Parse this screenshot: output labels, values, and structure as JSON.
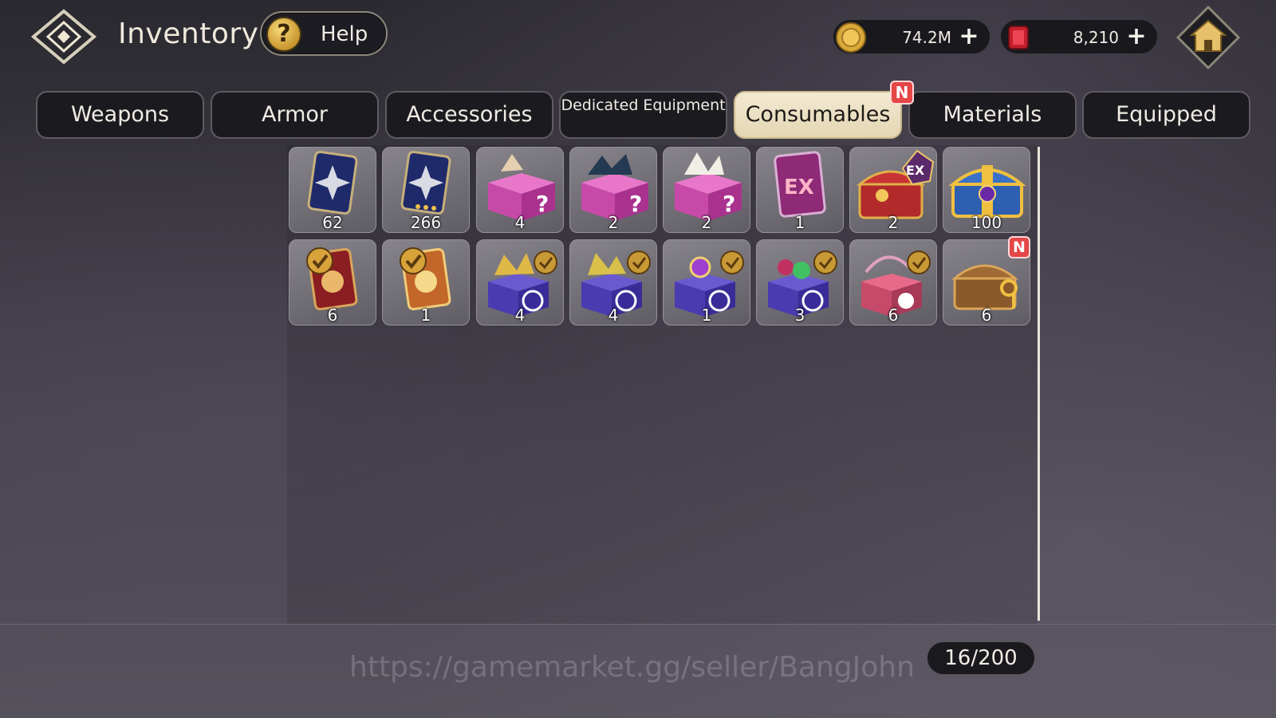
{
  "header": {
    "title": "Inventory",
    "help_label": "Help",
    "back_icon": "diamond-back-icon",
    "home_icon": "home-icon"
  },
  "currencies": [
    {
      "name": "gold",
      "value": "74.2M",
      "icon": "gold-coin-icon"
    },
    {
      "name": "gem",
      "value": "8,210",
      "icon": "red-gem-icon"
    }
  ],
  "tabs": [
    {
      "label": "Weapons",
      "active": false
    },
    {
      "label": "Armor",
      "active": false
    },
    {
      "label": "Accessories",
      "active": false
    },
    {
      "label": "Dedicated Equipment",
      "active": false
    },
    {
      "label": "Consumables",
      "active": true,
      "badge": "N"
    },
    {
      "label": "Materials",
      "active": false
    },
    {
      "label": "Equipped",
      "active": false
    }
  ],
  "items": [
    {
      "icon": "star-card-icon",
      "count": "62"
    },
    {
      "icon": "star-card-3star-icon",
      "count": "266"
    },
    {
      "icon": "mystery-box-icon",
      "count": "4"
    },
    {
      "icon": "mystery-box-dark-icon",
      "count": "2"
    },
    {
      "icon": "mystery-box-white-icon",
      "count": "2"
    },
    {
      "icon": "ex-card-icon",
      "count": "1"
    },
    {
      "icon": "ex-chest-icon",
      "count": "2"
    },
    {
      "icon": "gold-chest-icon",
      "count": "100"
    },
    {
      "icon": "select-card-red-icon",
      "count": "6"
    },
    {
      "icon": "select-card-gold-icon",
      "count": "1"
    },
    {
      "icon": "select-box-gold-icon",
      "count": "4"
    },
    {
      "icon": "select-box-purple-icon",
      "count": "4"
    },
    {
      "icon": "select-box-gem-icon",
      "count": "1"
    },
    {
      "icon": "select-box-green-icon",
      "count": "3"
    },
    {
      "icon": "select-box-red-icon",
      "count": "6"
    },
    {
      "icon": "key-chest-icon",
      "count": "6",
      "badge": "N"
    }
  ],
  "footer": {
    "watermark": "https://gamemarket.gg/seller/BangJohn",
    "capacity": "16/200"
  },
  "colors": {
    "tab_active_bg": "#e9ddbf",
    "badge_red": "#e54646",
    "panel_dark": "#1b1a1f"
  }
}
